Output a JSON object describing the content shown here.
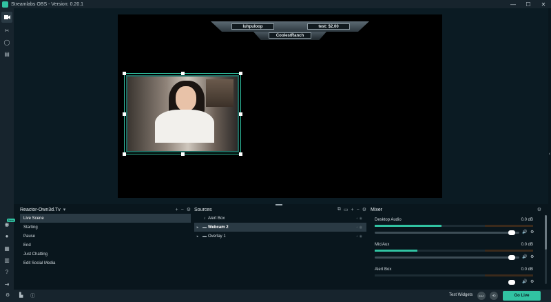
{
  "titlebar": {
    "title": "Streamlabs OBS - Version: 0.20.1",
    "minimize": "—",
    "maximize": "☐",
    "close": "✕"
  },
  "nav": {
    "items": [
      {
        "name": "editor",
        "icon": "camera-icon"
      },
      {
        "name": "themes",
        "icon": "wrench-icon"
      },
      {
        "name": "library",
        "icon": "search-icon"
      },
      {
        "name": "store",
        "icon": "store-icon"
      }
    ],
    "new_badge": "New"
  },
  "overlay": {
    "left_name": "luhpuloop",
    "right_name": "test: $2.00",
    "bottom_name": "CoolestRanch"
  },
  "scenes": {
    "collection": "Reactor-Own3d.Tv",
    "add": "+",
    "remove": "−",
    "settings": "⚙",
    "items": [
      "Live Scene",
      "Starting",
      "Pause",
      "End",
      "Just Chatting",
      "Edit Social Media"
    ]
  },
  "sources": {
    "title": "Sources",
    "items": [
      {
        "label": "Alert Box",
        "type": "bell-icon"
      },
      {
        "label": "Webcam 2",
        "type": "folder-icon"
      },
      {
        "label": "Overlay 1",
        "type": "folder-icon"
      }
    ]
  },
  "mixer": {
    "title": "Mixer",
    "channels": [
      {
        "name": "Desktop Audio",
        "db": "0.0 dB",
        "level": 0.42
      },
      {
        "name": "Mic/Aux",
        "db": "0.0 dB",
        "level": 0.27
      },
      {
        "name": "Alert Box",
        "db": "0.0 dB",
        "level": 0.0
      }
    ]
  },
  "footer": {
    "test_widgets": "Test Widgets",
    "rec": "REC",
    "replay": "⟲",
    "go_live": "Go Live"
  },
  "colors": {
    "accent": "#31c3a2",
    "background": "#09161d",
    "panel": "#17242d",
    "selected": "#2a3a44"
  }
}
